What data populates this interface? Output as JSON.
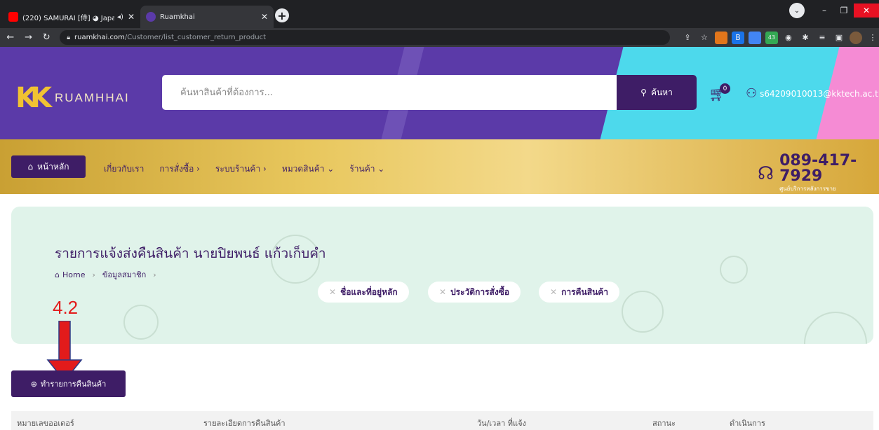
{
  "browser": {
    "tabs": [
      {
        "title": "(220) SAMURAI [侍] ◕ Japa",
        "icon": "youtube-icon",
        "active": false
      },
      {
        "title": "Ruamkhai",
        "icon": "ruamkhai-favicon",
        "active": true
      }
    ],
    "new_tab": "+",
    "url_host": "ruamkhai.com",
    "url_path": "/Customer/list_customer_return_product",
    "ext_badge": "43"
  },
  "header": {
    "logo_text": "RUAMHHAI",
    "search_placeholder": "ค้นหาสินค้าที่ต้องการ...",
    "search_button": "ค้นหา",
    "cart_count": "0",
    "user_email": "s64209010013@kktech.ac.th"
  },
  "nav": {
    "home": "หน้าหลัก",
    "items": [
      "เกี่ยวกับเรา",
      "การสั่งซื้อ ›",
      "ระบบร้านค้า ›",
      "หมวดสินค้า ⌄",
      "ร้านค้า ⌄"
    ],
    "hotline_number": "089-417-7929",
    "hotline_caption": "ศูนย์บริการหลังการขาย"
  },
  "banner": {
    "title": "รายการแจ้งส่งคืนสินค้า นายปิยพนธ์ แก้วเก็บคำ",
    "breadcrumb": [
      "Home",
      "ข้อมูลสมาชิก"
    ],
    "pills": [
      "ชื่อและที่อยู่หลัก",
      "ประวัติการสั่งซื้อ",
      "การคืนสินค้า"
    ]
  },
  "annotation": {
    "label": "4.2",
    "color": "#e21b1b"
  },
  "actions": {
    "return_button": "ทำรายการคืนสินค้า"
  },
  "table": {
    "columns": [
      "หมายเลขออเดอร์",
      "รายละเอียดการคืนสินค้า",
      "วัน/เวลา ที่แจ้ง",
      "สถานะ",
      "ดำเนินการ"
    ]
  },
  "colors": {
    "brand_purple": "#3e1d66",
    "header_purple": "#5b3aa8",
    "gold": "#e8c75d",
    "banner_mint": "#e0f3ea"
  }
}
